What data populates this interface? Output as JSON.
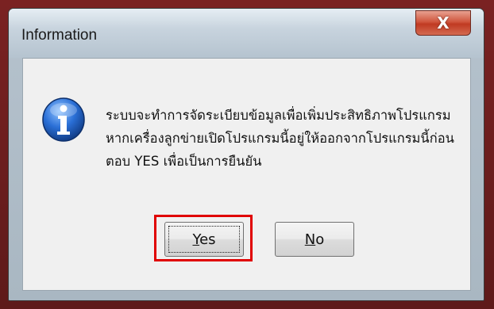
{
  "window": {
    "title": "Information",
    "close_label": "X"
  },
  "message": {
    "icon": "info-icon",
    "lines": [
      "ระบบจะทำการจัดระเบียบข้อมูลเพื่อเพิ่มประสิทธิภาพโปรแกรม",
      "หากเครื่องลูกข่ายเปิดโปรแกรมนี้อยู่ให้ออกจากโปรแกรมนี้ก่อน",
      "ตอบ YES เพื่อเป็นการยืนยัน"
    ]
  },
  "buttons": {
    "yes": {
      "label_mnemonic": "Y",
      "label_rest": "es"
    },
    "no": {
      "label_mnemonic": "N",
      "label_rest": "o"
    }
  },
  "annotation": {
    "highlight_color": "#e00000",
    "highlighted_button": "yes"
  },
  "colors": {
    "close_button": "#c03a22",
    "info_icon": "#2a6fd6"
  }
}
